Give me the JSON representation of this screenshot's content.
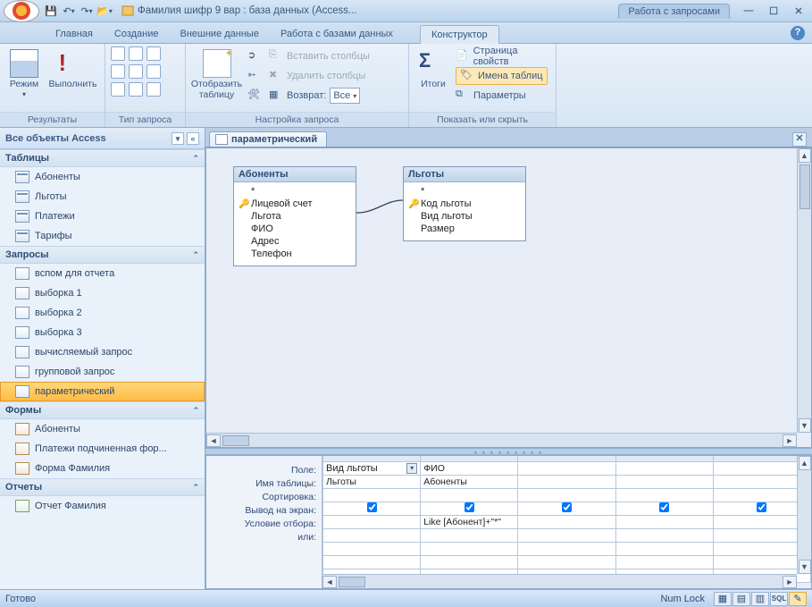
{
  "title": {
    "caption": "Фамилия шифр 9 вар : база данных (Access...",
    "context_group": "Работа с запросами"
  },
  "tabs": {
    "home": "Главная",
    "create": "Создание",
    "external": "Внешние данные",
    "dbtools": "Работа с базами данных",
    "design": "Конструктор"
  },
  "ribbon": {
    "results": {
      "label": "Результаты",
      "view": "Режим",
      "run": "Выполнить"
    },
    "querytype": {
      "label": "Тип запроса"
    },
    "setup": {
      "label": "Настройка запроса",
      "showtable": "Отобразить\nтаблицу",
      "insert_cols": "Вставить столбцы",
      "delete_cols": "Удалить столбцы",
      "return": "Возврат:",
      "return_val": "Все"
    },
    "showhide": {
      "label": "Показать или скрыть",
      "totals": "Итоги",
      "propsheet": "Страница свойств",
      "tablenames": "Имена таблиц",
      "params": "Параметры"
    }
  },
  "nav": {
    "header": "Все объекты Access",
    "tables": {
      "label": "Таблицы",
      "items": [
        "Абоненты",
        "Льготы",
        "Платежи",
        "Тарифы"
      ]
    },
    "queries": {
      "label": "Запросы",
      "items": [
        "вспом для отчета",
        "выборка 1",
        "выборка 2",
        "выборка 3",
        "вычисляемый запрос",
        "групповой запрос",
        "параметрический"
      ],
      "selected": 6
    },
    "forms": {
      "label": "Формы",
      "items": [
        "Абоненты",
        "Платежи подчиненная фор...",
        "Форма Фамилия"
      ]
    },
    "reports": {
      "label": "Отчеты",
      "items": [
        "Отчет Фамилия"
      ]
    }
  },
  "doc": {
    "tab": "параметрический",
    "tables": {
      "t1": {
        "title": "Абоненты",
        "fields": [
          "*",
          "Лицевой счет",
          "Льгота",
          "ФИО",
          "Адрес",
          "Телефон"
        ],
        "key_index": 1
      },
      "t2": {
        "title": "Льготы",
        "fields": [
          "*",
          "Код льготы",
          "Вид льготы",
          "Размер"
        ],
        "key_index": 1
      }
    }
  },
  "qbe": {
    "rows": {
      "field": "Поле:",
      "table": "Имя таблицы:",
      "sort": "Сортировка:",
      "show": "Вывод на экран:",
      "criteria": "Условие отбора:",
      "or": "или:"
    },
    "cols": [
      {
        "field": "Вид льготы",
        "table": "Льготы",
        "show": true,
        "criteria": ""
      },
      {
        "field": "ФИО",
        "table": "Абоненты",
        "show": true,
        "criteria": "Like [Абонент]+\"*\""
      },
      {
        "field": "",
        "table": "",
        "show": true,
        "criteria": ""
      },
      {
        "field": "",
        "table": "",
        "show": true,
        "criteria": ""
      },
      {
        "field": "",
        "table": "",
        "show": true,
        "criteria": ""
      }
    ]
  },
  "status": {
    "ready": "Готово",
    "numlock": "Num Lock"
  }
}
